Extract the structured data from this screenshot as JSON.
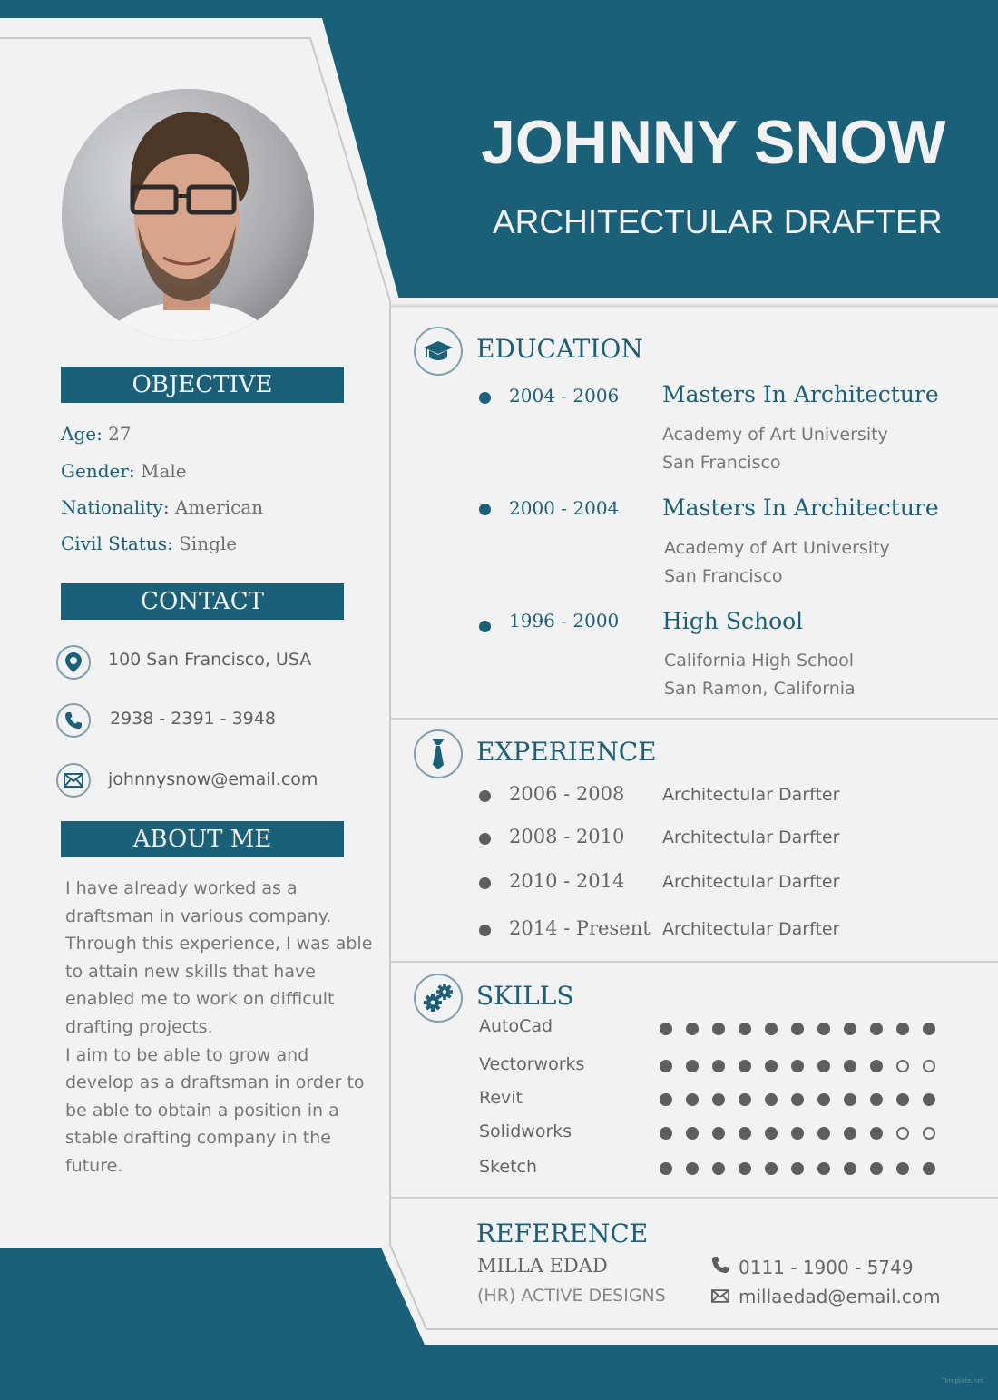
{
  "colors": {
    "accent": "#1b6079",
    "paper": "#f2f2f2",
    "text_grey": "#707070",
    "dot_grey": "#5e5e5e"
  },
  "header": {
    "name": "JOHNNY SNOW",
    "title": "ARCHITECTULAR DRAFTER"
  },
  "photo": {
    "alt": "Portrait of Johnny Snow"
  },
  "objective": {
    "heading": "OBJECTIVE",
    "items": [
      {
        "key": "Age:",
        "value": " 27"
      },
      {
        "key": "Gender:",
        "value": " Male"
      },
      {
        "key": "Nationality:",
        "value": " American"
      },
      {
        "key": "Civil Status:",
        "value": " Single"
      }
    ]
  },
  "contact": {
    "heading": "CONTACT",
    "items": [
      {
        "icon": "map-pin-icon",
        "text": "100 San Francisco, USA"
      },
      {
        "icon": "phone-icon",
        "text": "2938 - 2391 - 3948"
      },
      {
        "icon": "envelope-icon",
        "text": "johnnysnow@email.com"
      }
    ]
  },
  "about": {
    "heading": "ABOUT ME",
    "paragraph1": "I have already worked as a draftsman in various company. Through this experience, I was able to attain new skills that have enabled me to work on difficult drafting projects.",
    "paragraph2": "I aim to be able to grow and develop as a draftsman in order to be able to obtain a position in a stable drafting company in the future."
  },
  "education": {
    "heading": "EDUCATION",
    "icon": "graduation-cap-icon",
    "items": [
      {
        "years": "2004 - 2006",
        "degree": "Masters In Architecture",
        "school": "Academy of Art University",
        "location": "San Francisco"
      },
      {
        "years": "2000 - 2004",
        "degree": "Masters In Architecture",
        "school": "Academy of Art University",
        "location": "San Francisco"
      },
      {
        "years": "1996 - 2000",
        "degree": "High School",
        "school": "California High School",
        "location": "San Ramon, California"
      }
    ]
  },
  "experience": {
    "heading": "EXPERIENCE",
    "icon": "necktie-icon",
    "items": [
      {
        "years": "2006 - 2008",
        "role": "Architectular Darfter"
      },
      {
        "years": "2008 - 2010",
        "role": "Architectular Darfter"
      },
      {
        "years": "2010 - 2014",
        "role": "Architectular Darfter"
      },
      {
        "years": "2014 - Present",
        "role": "Architectular Darfter"
      }
    ]
  },
  "skills": {
    "heading": "SKILLS",
    "icon": "gears-icon",
    "max": 11,
    "items": [
      {
        "name": "AutoCad",
        "level": 11
      },
      {
        "name": "Vectorworks",
        "level": 9
      },
      {
        "name": "Revit",
        "level": 11
      },
      {
        "name": "Solidworks",
        "level": 9
      },
      {
        "name": "Sketch",
        "level": 11
      }
    ]
  },
  "reference": {
    "heading": "REFERENCE",
    "name": "MILLA EDAD",
    "company": "(HR) ACTIVE DESIGNS",
    "phone": "0111 - 1900 - 5749",
    "email": "millaedad@email.com"
  },
  "watermark": "Template.net"
}
